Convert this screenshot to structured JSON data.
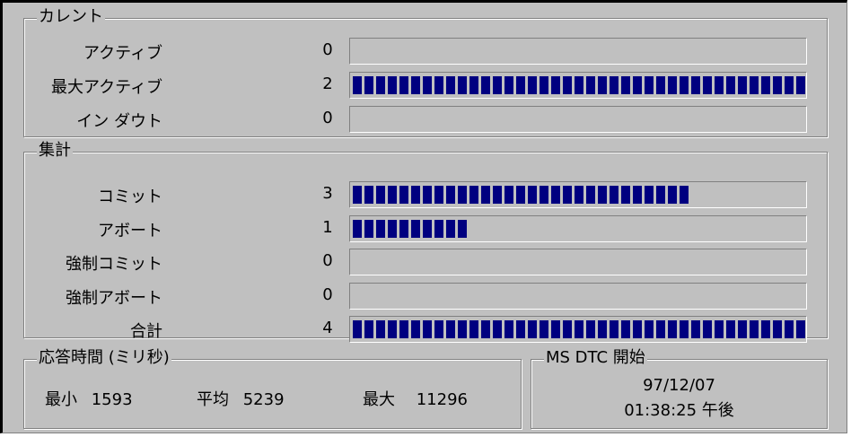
{
  "current": {
    "title": "カレント",
    "rows": [
      {
        "label": "アクティブ",
        "value": "0",
        "fraction": 0
      },
      {
        "label": "最大アクティブ",
        "value": "2",
        "fraction": 1.0
      },
      {
        "label": "イン ダウト",
        "value": "0",
        "fraction": 0
      }
    ]
  },
  "aggregate": {
    "title": "集計",
    "rows": [
      {
        "label": "コミット",
        "value": "3",
        "fraction": 0.75
      },
      {
        "label": "アボート",
        "value": "1",
        "fraction": 0.25
      },
      {
        "label": "強制コミット",
        "value": "0",
        "fraction": 0
      },
      {
        "label": "強制アボート",
        "value": "0",
        "fraction": 0
      },
      {
        "label": "合計",
        "value": "4",
        "fraction": 1.0
      }
    ]
  },
  "response": {
    "title": "応答時間 (ミリ秒)",
    "min_label": "最小",
    "min_value": "1593",
    "avg_label": "平均",
    "avg_value": "5239",
    "max_label": "最大",
    "max_value": "11296"
  },
  "dtc": {
    "title": "MS DTC 開始",
    "date": "97/12/07",
    "time": "01:38:25 午後"
  },
  "colors": {
    "meter_fill": "#000080",
    "background": "#c0c0c0"
  }
}
